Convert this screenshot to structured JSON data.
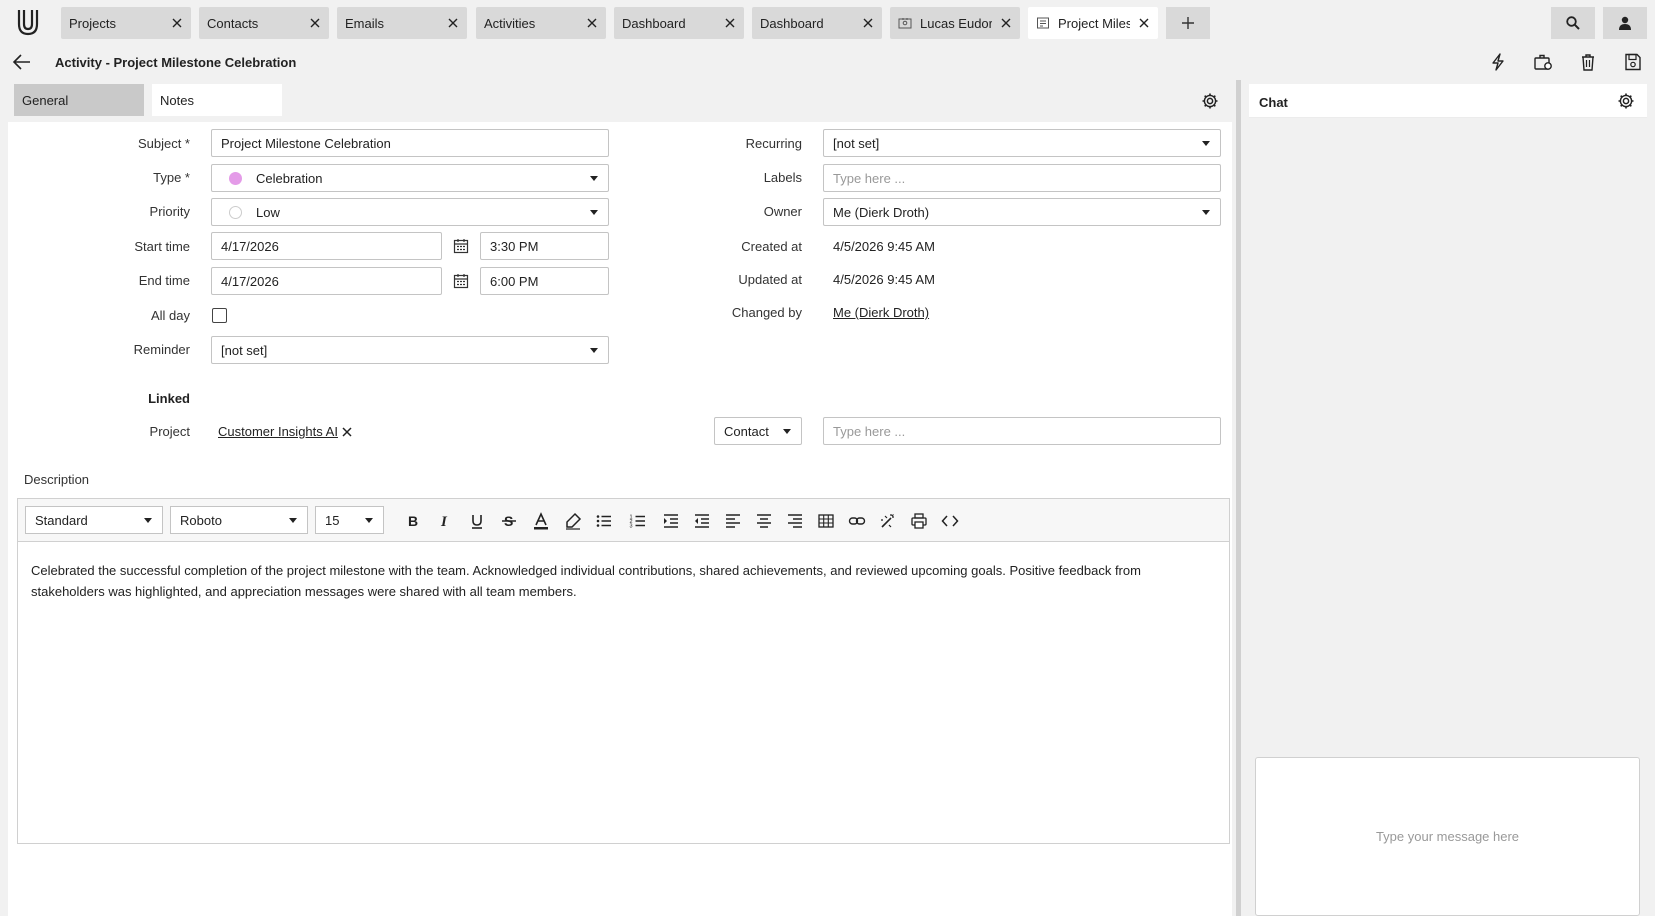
{
  "tabs": [
    {
      "label": "Projects"
    },
    {
      "label": "Contacts"
    },
    {
      "label": "Emails"
    },
    {
      "label": "Activities"
    },
    {
      "label": "Dashboard"
    },
    {
      "label": "Dashboard"
    },
    {
      "label": "Lucas Eudora…"
    },
    {
      "label": "Project Milest…"
    }
  ],
  "header": {
    "title": "Activity - Project Milestone Celebration"
  },
  "form_tabs": {
    "general": "General",
    "notes": "Notes"
  },
  "form": {
    "subject": {
      "label": "Subject *",
      "value": "Project Milestone Celebration"
    },
    "type": {
      "label": "Type *",
      "value": "Celebration",
      "dot_color": "#e49be8"
    },
    "priority": {
      "label": "Priority",
      "value": "Low"
    },
    "start": {
      "label": "Start time",
      "date": "4/17/2026",
      "time": "3:30 PM"
    },
    "end": {
      "label": "End time",
      "date": "4/17/2026",
      "time": "6:00 PM"
    },
    "allday": {
      "label": "All day"
    },
    "reminder": {
      "label": "Reminder",
      "value": "[not set]"
    },
    "recurring": {
      "label": "Recurring",
      "value": "[not set]"
    },
    "labels": {
      "label": "Labels",
      "placeholder": "Type here ..."
    },
    "owner": {
      "label": "Owner",
      "value": "Me (Dierk Droth)"
    },
    "created": {
      "label": "Created at",
      "value": "4/5/2026 9:45 AM"
    },
    "updated": {
      "label": "Updated at",
      "value": "4/5/2026 9:45 AM"
    },
    "changed": {
      "label": "Changed by",
      "value": "Me (Dierk Droth)"
    }
  },
  "linked": {
    "heading": "Linked",
    "project_label": "Project",
    "project_value": "Customer Insights AI",
    "contact_select": "Contact",
    "contact_placeholder": "Type here ..."
  },
  "description": {
    "label": "Description",
    "style": "Standard",
    "font": "Roboto",
    "size": "15",
    "text": "Celebrated the successful completion of the project milestone with the team. Acknowledged individual contributions, shared achievements, and reviewed upcoming goals. Positive feedback from stakeholders was highlighted, and appreciation messages were shared with all team members."
  },
  "chat": {
    "title": "Chat",
    "placeholder": "Type your message here"
  }
}
